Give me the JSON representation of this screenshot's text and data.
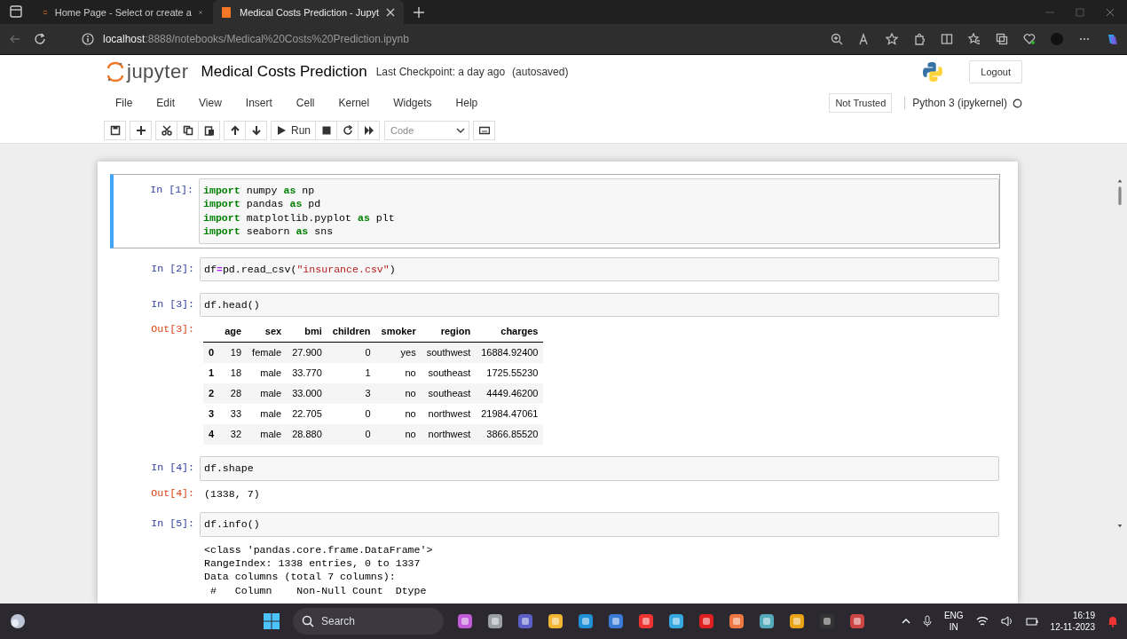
{
  "browser": {
    "tabs": [
      {
        "title": "Home Page - Select or create a",
        "selected": false
      },
      {
        "title": "Medical Costs Prediction - Jupyt",
        "selected": true
      }
    ],
    "address": {
      "host": "localhost",
      "path": ":8888/notebooks/Medical%20Costs%20Prediction.ipynb"
    }
  },
  "header": {
    "logo": "jupyter",
    "title": "Medical Costs Prediction",
    "checkpoint": "Last Checkpoint: a day ago",
    "autosaved": "(autosaved)",
    "logout": "Logout"
  },
  "menu": [
    "File",
    "Edit",
    "View",
    "Insert",
    "Cell",
    "Kernel",
    "Widgets",
    "Help"
  ],
  "trust": "Not Trusted",
  "kernel": {
    "name": "Python 3 (ipykernel)",
    "busy": false
  },
  "toolbar": {
    "run": "Run",
    "cell_type": "Code"
  },
  "cells": [
    {
      "prompt": "In [1]:",
      "selected": true,
      "code": [
        [
          {
            "kind": "kw",
            "text": "import"
          },
          {
            "kind": "plain",
            "text": " numpy "
          },
          {
            "kind": "kw",
            "text": "as"
          },
          {
            "kind": "plain",
            "text": " np"
          }
        ],
        [
          {
            "kind": "kw",
            "text": "import"
          },
          {
            "kind": "plain",
            "text": " pandas "
          },
          {
            "kind": "kw",
            "text": "as"
          },
          {
            "kind": "plain",
            "text": " pd"
          }
        ],
        [
          {
            "kind": "kw",
            "text": "import"
          },
          {
            "kind": "plain",
            "text": " matplotlib.pyplot "
          },
          {
            "kind": "kw",
            "text": "as"
          },
          {
            "kind": "plain",
            "text": " plt"
          }
        ],
        [
          {
            "kind": "kw",
            "text": "import"
          },
          {
            "kind": "plain",
            "text": " seaborn "
          },
          {
            "kind": "kw",
            "text": "as"
          },
          {
            "kind": "plain",
            "text": " sns"
          }
        ]
      ]
    },
    {
      "prompt": "In [2]:",
      "selected": false,
      "code": [
        [
          {
            "kind": "plain",
            "text": "df"
          },
          {
            "kind": "op",
            "text": "="
          },
          {
            "kind": "plain",
            "text": "pd.read_csv("
          },
          {
            "kind": "str",
            "text": "\"insurance.csv\""
          },
          {
            "kind": "plain",
            "text": ")"
          }
        ]
      ]
    },
    {
      "prompt": "In [3]:",
      "selected": false,
      "code": [
        [
          {
            "kind": "plain",
            "text": "df.head()"
          }
        ]
      ],
      "output": {
        "prompt": "Out[3]:",
        "kind": "table",
        "columns": [
          "age",
          "sex",
          "bmi",
          "children",
          "smoker",
          "region",
          "charges"
        ],
        "rows": [
          {
            "index": "0",
            "cells": [
              "19",
              "female",
              "27.900",
              "0",
              "yes",
              "southwest",
              "16884.92400"
            ]
          },
          {
            "index": "1",
            "cells": [
              "18",
              "male",
              "33.770",
              "1",
              "no",
              "southeast",
              "1725.55230"
            ]
          },
          {
            "index": "2",
            "cells": [
              "28",
              "male",
              "33.000",
              "3",
              "no",
              "southeast",
              "4449.46200"
            ]
          },
          {
            "index": "3",
            "cells": [
              "33",
              "male",
              "22.705",
              "0",
              "no",
              "northwest",
              "21984.47061"
            ]
          },
          {
            "index": "4",
            "cells": [
              "32",
              "male",
              "28.880",
              "0",
              "no",
              "northwest",
              "3866.85520"
            ]
          }
        ]
      }
    },
    {
      "prompt": "In [4]:",
      "selected": false,
      "code": [
        [
          {
            "kind": "plain",
            "text": "df.shape"
          }
        ]
      ],
      "output": {
        "prompt": "Out[4]:",
        "kind": "text",
        "lines": [
          "(1338, 7)"
        ]
      }
    },
    {
      "prompt": "In [5]:",
      "selected": false,
      "code": [
        [
          {
            "kind": "plain",
            "text": "df.info()"
          }
        ]
      ],
      "output": {
        "kind": "text",
        "lines": [
          "<class 'pandas.core.frame.DataFrame'>",
          "RangeIndex: 1338 entries, 0 to 1337",
          "Data columns (total 7 columns):",
          " #   Column    Non-Null Count  Dtype"
        ]
      }
    }
  ],
  "taskbar": {
    "search": "Search",
    "language": "ENG",
    "region": "IN",
    "time": "16:19",
    "date": "12-11-2023"
  }
}
